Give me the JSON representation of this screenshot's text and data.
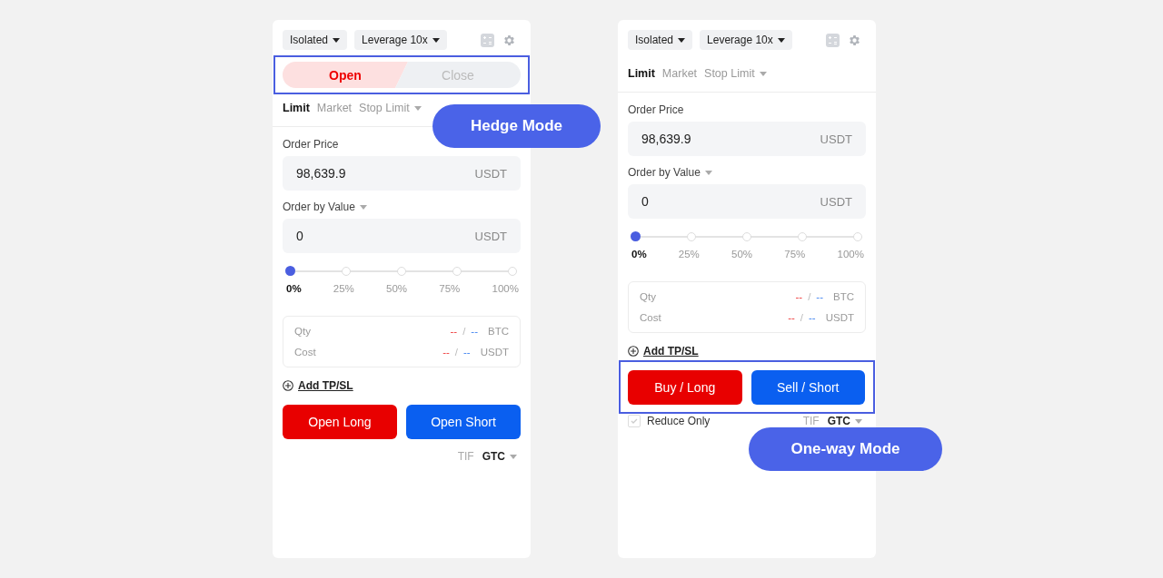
{
  "panels": [
    {
      "margin_mode": "Isolated",
      "leverage": "Leverage 10x",
      "position_tabs": [
        {
          "label": "Open",
          "selected": true
        },
        {
          "label": "Close",
          "selected": false
        }
      ],
      "order_types": [
        {
          "label": "Limit",
          "selected": true
        },
        {
          "label": "Market",
          "selected": false
        },
        {
          "label": "Stop Limit",
          "selected": false
        }
      ],
      "order_price": {
        "label": "Order Price",
        "value": "98,639.9",
        "unit": "USDT"
      },
      "order_value": {
        "label": "Order by Value",
        "value": "0",
        "unit": "USDT"
      },
      "slider": {
        "level": 0,
        "ticks": [
          "0%",
          "25%",
          "50%",
          "75%",
          "100%"
        ]
      },
      "summary": [
        {
          "label": "Qty",
          "buy": "--",
          "sep": "/",
          "sell": "--",
          "unit": "BTC"
        },
        {
          "label": "Cost",
          "buy": "--",
          "sep": "/",
          "sell": "--",
          "unit": "USDT"
        }
      ],
      "add_tpsl": "Add TP/SL",
      "buttons": [
        {
          "label": "Open Long",
          "kind": "long"
        },
        {
          "label": "Open Short",
          "kind": "short"
        }
      ],
      "tabs_highlighted": true,
      "buttons_highlighted": false,
      "tif": {
        "label": "TIF",
        "value": "GTC"
      },
      "callout": "Hedge Mode"
    },
    {
      "margin_mode": "Isolated",
      "leverage": "Leverage 10x",
      "order_types": [
        {
          "label": "Limit",
          "selected": true
        },
        {
          "label": "Market",
          "selected": false
        },
        {
          "label": "Stop Limit",
          "selected": false
        }
      ],
      "order_price": {
        "label": "Order Price",
        "value": "98,639.9",
        "unit": "USDT"
      },
      "order_value": {
        "label": "Order by Value",
        "value": "0",
        "unit": "USDT"
      },
      "slider": {
        "level": 0,
        "ticks": [
          "0%",
          "25%",
          "50%",
          "75%",
          "100%"
        ]
      },
      "summary": [
        {
          "label": "Qty",
          "buy": "--",
          "sep": "/",
          "sell": "--",
          "unit": "BTC"
        },
        {
          "label": "Cost",
          "buy": "--",
          "sep": "/",
          "sell": "--",
          "unit": "USDT"
        }
      ],
      "add_tpsl": "Add TP/SL",
      "buttons": [
        {
          "label": "Buy / Long",
          "kind": "long"
        },
        {
          "label": "Sell / Short",
          "kind": "short"
        }
      ],
      "buttons_highlighted": true,
      "reduce_only": {
        "label": "Reduce Only",
        "checked": false
      },
      "tif": {
        "label": "TIF",
        "value": "GTC"
      },
      "callout": "One-way Mode"
    }
  ]
}
